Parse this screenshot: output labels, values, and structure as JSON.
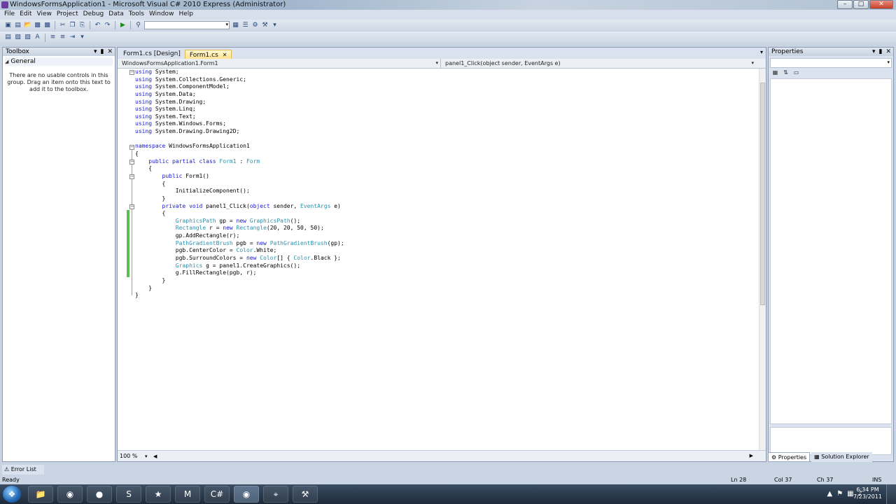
{
  "window": {
    "title": "WindowsFormsApplication1 - Microsoft Visual C# 2010 Express (Administrator)"
  },
  "menu": [
    "File",
    "Edit",
    "View",
    "Project",
    "Debug",
    "Data",
    "Tools",
    "Window",
    "Help"
  ],
  "toolbox": {
    "title": "Toolbox",
    "group": "General",
    "message": "There are no usable controls in this group. Drag an item onto this text to add it to the toolbox."
  },
  "editor": {
    "tabs": [
      {
        "label": "Form1.cs [Design]",
        "active": false
      },
      {
        "label": "Form1.cs",
        "active": true
      }
    ],
    "nav_left": "WindowsFormsApplication1.Form1",
    "nav_right": "panel1_Click(object sender, EventArgs e)",
    "zoom": "100 %",
    "code": [
      [
        [
          "kw",
          "using"
        ],
        [
          "t",
          " System;"
        ]
      ],
      [
        [
          "kw",
          "using"
        ],
        [
          "t",
          " System.Collections.Generic;"
        ]
      ],
      [
        [
          "kw",
          "using"
        ],
        [
          "t",
          " System.ComponentModel;"
        ]
      ],
      [
        [
          "kw",
          "using"
        ],
        [
          "t",
          " System.Data;"
        ]
      ],
      [
        [
          "kw",
          "using"
        ],
        [
          "t",
          " System.Drawing;"
        ]
      ],
      [
        [
          "kw",
          "using"
        ],
        [
          "t",
          " System.Linq;"
        ]
      ],
      [
        [
          "kw",
          "using"
        ],
        [
          "t",
          " System.Text;"
        ]
      ],
      [
        [
          "kw",
          "using"
        ],
        [
          "t",
          " System.Windows.Forms;"
        ]
      ],
      [
        [
          "kw",
          "using"
        ],
        [
          "t",
          " System.Drawing.Drawing2D;"
        ]
      ],
      [],
      [
        [
          "kw",
          "namespace"
        ],
        [
          "t",
          " WindowsFormsApplication1"
        ]
      ],
      [
        [
          "t",
          "{"
        ]
      ],
      [
        [
          "t",
          "    "
        ],
        [
          "kw",
          "public partial class"
        ],
        [
          "t",
          " "
        ],
        [
          "ty",
          "Form1"
        ],
        [
          "t",
          " : "
        ],
        [
          "ty",
          "Form"
        ]
      ],
      [
        [
          "t",
          "    {"
        ]
      ],
      [
        [
          "t",
          "        "
        ],
        [
          "kw",
          "public"
        ],
        [
          "t",
          " Form1()"
        ]
      ],
      [
        [
          "t",
          "        {"
        ]
      ],
      [
        [
          "t",
          "            InitializeComponent();"
        ]
      ],
      [
        [
          "t",
          "        }"
        ]
      ],
      [
        [
          "t",
          "        "
        ],
        [
          "kw",
          "private void"
        ],
        [
          "t",
          " panel1_Click("
        ],
        [
          "kw",
          "object"
        ],
        [
          "t",
          " sender, "
        ],
        [
          "ty",
          "EventArgs"
        ],
        [
          "t",
          " e)"
        ]
      ],
      [
        [
          "t",
          "        {"
        ]
      ],
      [
        [
          "t",
          "            "
        ],
        [
          "ty",
          "GraphicsPath"
        ],
        [
          "t",
          " gp = "
        ],
        [
          "kw",
          "new"
        ],
        [
          "t",
          " "
        ],
        [
          "ty",
          "GraphicsPath"
        ],
        [
          "t",
          "();"
        ]
      ],
      [
        [
          "t",
          "            "
        ],
        [
          "ty",
          "Rectangle"
        ],
        [
          "t",
          " r = "
        ],
        [
          "kw",
          "new"
        ],
        [
          "t",
          " "
        ],
        [
          "ty",
          "Rectangle"
        ],
        [
          "t",
          "(20, 20, 50, 50);"
        ]
      ],
      [
        [
          "t",
          "            gp.AddRectangle(r);"
        ]
      ],
      [
        [
          "t",
          "            "
        ],
        [
          "ty",
          "PathGradientBrush"
        ],
        [
          "t",
          " pgb = "
        ],
        [
          "kw",
          "new"
        ],
        [
          "t",
          " "
        ],
        [
          "ty",
          "PathGradientBrush"
        ],
        [
          "t",
          "(gp);"
        ]
      ],
      [
        [
          "t",
          "            pgb.CenterColor = "
        ],
        [
          "ty",
          "Color"
        ],
        [
          "t",
          ".White;"
        ]
      ],
      [
        [
          "t",
          "            pgb.SurroundColors = "
        ],
        [
          "kw",
          "new"
        ],
        [
          "t",
          " "
        ],
        [
          "ty",
          "Color"
        ],
        [
          "t",
          "[] { "
        ],
        [
          "ty",
          "Color"
        ],
        [
          "t",
          ".Black };"
        ]
      ],
      [
        [
          "t",
          "            "
        ],
        [
          "ty",
          "Graphics"
        ],
        [
          "t",
          " g = panel1.CreateGraphics();"
        ]
      ],
      [
        [
          "t",
          "            g.FillRectangle(pgb, r);"
        ]
      ],
      [
        [
          "t",
          "        }"
        ]
      ],
      [
        [
          "t",
          "    }"
        ]
      ],
      [
        [
          "t",
          "}"
        ]
      ]
    ]
  },
  "properties": {
    "title": "Properties",
    "tabs": [
      "Properties",
      "Solution Explorer"
    ]
  },
  "error_list": "Error List",
  "status": {
    "text": "Ready",
    "ln": "Ln 28",
    "col": "Col 37",
    "ch": "Ch 37",
    "ins": "INS"
  },
  "clock": {
    "time": "6:34 PM",
    "date": "7/23/2011"
  },
  "colors": {
    "keyword": "#1717d9",
    "type": "#2b91af",
    "change_bar": "#5bbd52",
    "active_tab": "#ffe28c"
  }
}
